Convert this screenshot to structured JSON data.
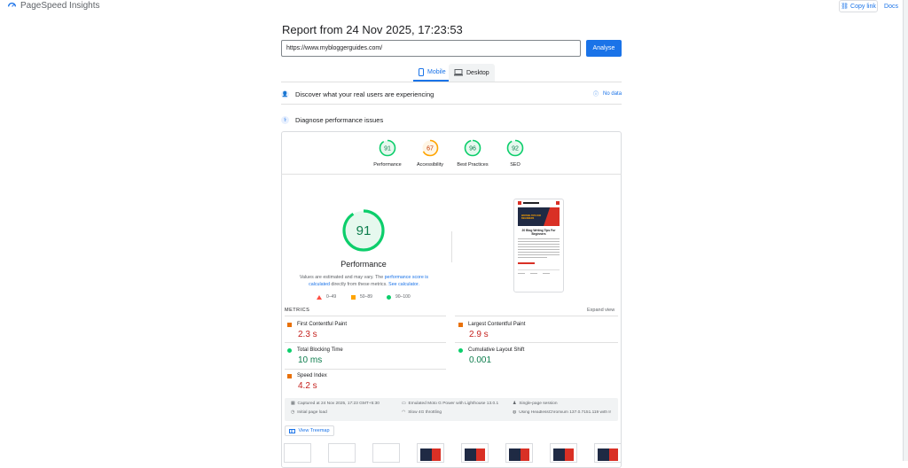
{
  "header": {
    "brand": "PageSpeed Insights",
    "copy_link": "Copy link",
    "docs": "Docs"
  },
  "report": {
    "title": "Report from 24 Nov 2025, 17:23:53",
    "url_value": "https://www.mybloggerguides.com/",
    "analyse_label": "Analyse"
  },
  "tabs": [
    {
      "label": "Mobile",
      "active": true
    },
    {
      "label": "Desktop",
      "active": false
    }
  ],
  "sections": {
    "discover": "Discover what your real users are experiencing",
    "no_data": "No data",
    "diagnose": "Diagnose performance issues"
  },
  "scores": [
    {
      "label": "Performance",
      "value": "91",
      "color": "#0cce6b",
      "fraction": 0.91
    },
    {
      "label": "Accessibility",
      "value": "67",
      "color": "#ffa400",
      "fraction": 0.67
    },
    {
      "label": "Best Practices",
      "value": "96",
      "color": "#0cce6b",
      "fraction": 0.96
    },
    {
      "label": "SEO",
      "value": "92",
      "color": "#0cce6b",
      "fraction": 0.92
    }
  ],
  "performance": {
    "score": "91",
    "fraction": 0.91,
    "title": "Performance",
    "note_prefix": "Values are estimated and may vary. The ",
    "note_link1": "performance score is calculated",
    "note_mid": " directly from these metrics. ",
    "note_link2": "See calculator."
  },
  "legend": {
    "fail": "0–49",
    "average": "50–89",
    "pass": "90–100"
  },
  "thumbnail": {
    "headline": "20 Blog Writing Tips For Beginners",
    "banner": "WRITING TIPS FOR BEGINNERS"
  },
  "metrics_section": {
    "label": "METRICS",
    "expand": "Expand view",
    "items": [
      {
        "name": "First Contentful Paint",
        "value": "2.3 s",
        "status": "average"
      },
      {
        "name": "Largest Contentful Paint",
        "value": "2.9 s",
        "status": "average"
      },
      {
        "name": "Total Blocking Time",
        "value": "10 ms",
        "status": "pass"
      },
      {
        "name": "Cumulative Layout Shift",
        "value": "0.001",
        "status": "pass"
      },
      {
        "name": "Speed Index",
        "value": "4.2 s",
        "status": "average"
      }
    ]
  },
  "run_info": {
    "captured": "Captured at 24 Nov 2025, 17:23 GMT+5:30",
    "emulated": "Emulated Moto G Power with Lighthouse 13.0.1",
    "session": "Single-page session",
    "initial": "Initial page load",
    "throttling": "Slow 4G throttling",
    "browser": "Using HeadlessChromium 137.0.7151.119 with lr"
  },
  "treemap": "View Treemap",
  "colors": {
    "accent": "#1a73e8",
    "pass": "#0cce6b",
    "average": "#ffa400",
    "average_value": "#c5221f",
    "pass_value": "#0d7d4d"
  }
}
